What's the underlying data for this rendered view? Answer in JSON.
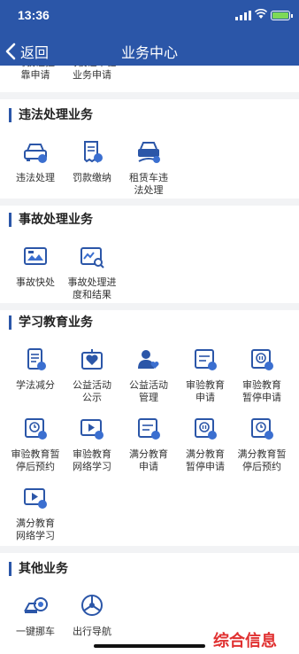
{
  "status_bar": {
    "time": "13:36"
  },
  "nav": {
    "back_label": "返回",
    "title": "业务中心"
  },
  "partial_items": [
    {
      "label": "驾驶证挂\n靠申请"
    },
    {
      "label": "驾驶证审验\n业务申请"
    }
  ],
  "sections": {
    "violation": {
      "title": "违法处理业务",
      "items": [
        {
          "label": "违法处理",
          "icon": "car-violation-icon"
        },
        {
          "label": "罚款缴纳",
          "icon": "receipt-icon"
        },
        {
          "label": "租赁车违\n法处理",
          "icon": "rental-car-icon"
        }
      ]
    },
    "accident": {
      "title": "事故处理业务",
      "items": [
        {
          "label": "事故快处",
          "icon": "accident-photo-icon"
        },
        {
          "label": "事故处理进\n度和结果",
          "icon": "accident-progress-icon"
        }
      ]
    },
    "education": {
      "title": "学习教育业务",
      "items": [
        {
          "label": "学法减分",
          "icon": "study-book-icon"
        },
        {
          "label": "公益活动\n公示",
          "icon": "charity-board-icon"
        },
        {
          "label": "公益活动\n管理",
          "icon": "charity-manage-icon"
        },
        {
          "label": "审验教育\n申请",
          "icon": "review-apply-icon"
        },
        {
          "label": "审验教育\n暂停申请",
          "icon": "review-pause-icon"
        },
        {
          "label": "审验教育暂\n停后预约",
          "icon": "review-appointment-icon"
        },
        {
          "label": "审验教育\n网络学习",
          "icon": "review-online-icon"
        },
        {
          "label": "满分教育\n申请",
          "icon": "fullscore-apply-icon"
        },
        {
          "label": "满分教育\n暂停申请",
          "icon": "fullscore-pause-icon"
        },
        {
          "label": "满分教育暂\n停后预约",
          "icon": "fullscore-appointment-icon"
        },
        {
          "label": "满分教育\n网络学习",
          "icon": "fullscore-online-icon"
        }
      ]
    },
    "other": {
      "title": "其他业务",
      "items": [
        {
          "label": "一键挪车",
          "icon": "move-car-icon"
        },
        {
          "label": "出行导航",
          "icon": "navigation-icon"
        }
      ]
    }
  },
  "watermark": "综合信息",
  "colors": {
    "brand_blue": "#2b56a8",
    "badge_blue": "#3b6fd0",
    "watermark_red": "#e03030"
  }
}
